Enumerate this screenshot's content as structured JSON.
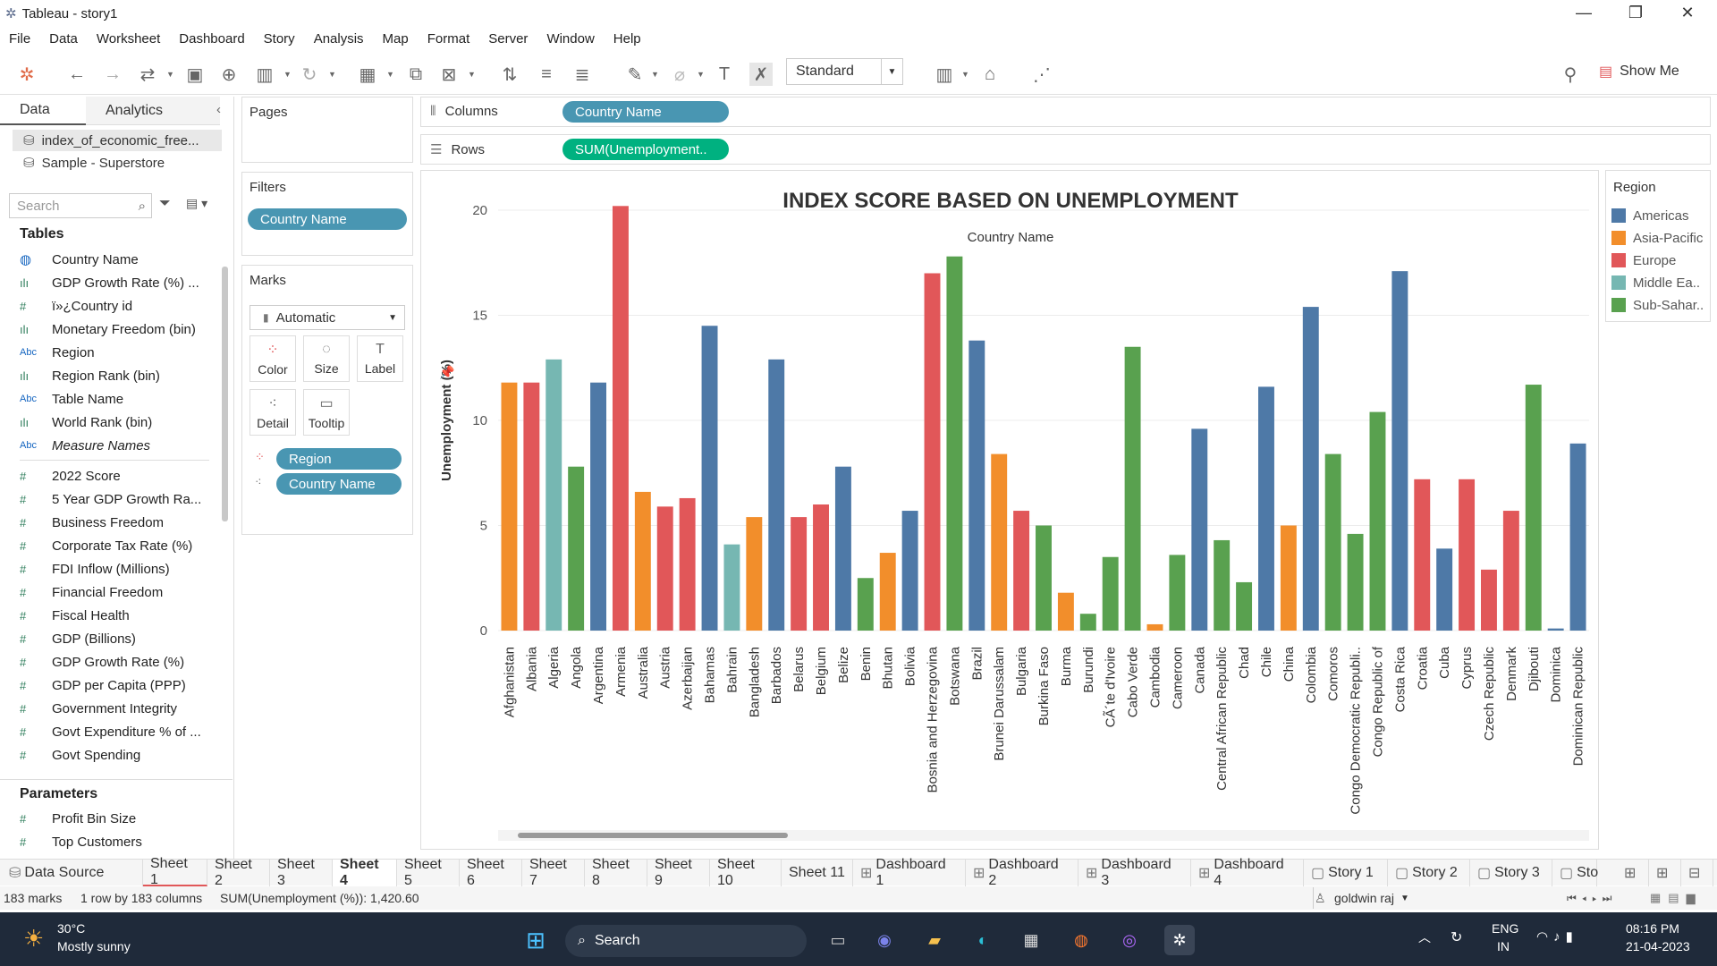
{
  "window": {
    "title": "Tableau - story1",
    "minimize": "—",
    "restore": "❐",
    "close": "✕"
  },
  "menu": [
    "File",
    "Data",
    "Worksheet",
    "Dashboard",
    "Story",
    "Analysis",
    "Map",
    "Format",
    "Server",
    "Window",
    "Help"
  ],
  "toolbar": {
    "fit_value": "Standard",
    "show_me": "Show Me"
  },
  "left_pane": {
    "tabs": [
      "Data",
      "Analytics"
    ],
    "data_sources": [
      "index_of_economic_free...",
      "Sample - Superstore"
    ],
    "search_placeholder": "Search",
    "tables_heading": "Tables",
    "dimensions": [
      {
        "icon": "globe",
        "name": "Country Name"
      },
      {
        "icon": "bin",
        "name": "GDP Growth Rate (%) ..."
      },
      {
        "icon": "num",
        "name": "ï»¿Country id"
      },
      {
        "icon": "bin",
        "name": "Monetary Freedom (bin)"
      },
      {
        "icon": "abc",
        "name": "Region"
      },
      {
        "icon": "bin",
        "name": "Region Rank (bin)"
      },
      {
        "icon": "abc",
        "name": "Table Name"
      },
      {
        "icon": "bin",
        "name": "World Rank (bin)"
      },
      {
        "icon": "abc",
        "name": "Measure Names"
      }
    ],
    "measures": [
      "2022 Score",
      "5 Year GDP Growth Ra...",
      "Business Freedom",
      "Corporate Tax Rate (%)",
      "FDI Inflow (Millions)",
      "Financial Freedom",
      "Fiscal Health",
      "GDP (Billions)",
      "GDP Growth Rate (%)",
      "GDP per Capita (PPP)",
      "Government Integrity",
      "Govt Expenditure % of ...",
      "Govt Spending"
    ],
    "parameters_heading": "Parameters",
    "parameters": [
      "Profit Bin Size",
      "Top Customers"
    ]
  },
  "shelves": {
    "pages": "Pages",
    "filters": "Filters",
    "filter_pill": "Country Name",
    "marks": "Marks",
    "mark_type": "Automatic",
    "mark_buttons": [
      "Color",
      "Size",
      "Label",
      "Detail",
      "Tooltip"
    ],
    "mark_pills": [
      "Region",
      "Country Name"
    ],
    "columns_label": "Columns",
    "columns_pill": "Country Name",
    "rows_label": "Rows",
    "rows_pill": "SUM(Unemployment.."
  },
  "legend": {
    "title": "Region",
    "items": [
      {
        "name": "Americas",
        "color": "#4e79a7"
      },
      {
        "name": "Asia-Pacific",
        "color": "#f28e2b"
      },
      {
        "name": "Europe",
        "color": "#e15759"
      },
      {
        "name": "Middle Ea..",
        "color": "#76b7b2"
      },
      {
        "name": "Sub-Sahar..",
        "color": "#59a14f"
      }
    ]
  },
  "chart_data": {
    "type": "bar",
    "title": "INDEX SCORE BASED ON UNEMPLOYMENT",
    "subtitle": "Country Name",
    "ylabel": "Unemployment (%)",
    "ylim": [
      0,
      20
    ],
    "yticks": [
      0,
      5,
      10,
      15,
      20
    ],
    "grid": true,
    "categories": [
      "Afghanistan",
      "Albania",
      "Algeria",
      "Angola",
      "Argentina",
      "Armenia",
      "Australia",
      "Austria",
      "Azerbaijan",
      "Bahamas",
      "Bahrain",
      "Bangladesh",
      "Barbados",
      "Belarus",
      "Belgium",
      "Belize",
      "Benin",
      "Bhutan",
      "Bolivia",
      "Bosnia and Herzegovina",
      "Botswana",
      "Brazil",
      "Brunei Darussalam",
      "Bulgaria",
      "Burkina Faso",
      "Burma",
      "Burundi",
      "CÃ´te d'Ivoire",
      "Cabo Verde",
      "Cambodia",
      "Cameroon",
      "Canada",
      "Central African Republic",
      "Chad",
      "Chile",
      "China",
      "Colombia",
      "Comoros",
      "Congo Democratic Republi..",
      "Congo Republic of",
      "Costa Rica",
      "Croatia",
      "Cuba",
      "Cyprus",
      "Czech Republic",
      "Denmark",
      "Djibouti",
      "Dominica",
      "Dominican Republic"
    ],
    "regions": [
      "Asia-Pacific",
      "Europe",
      "Middle Ea..",
      "Sub-Sahar..",
      "Americas",
      "Europe",
      "Asia-Pacific",
      "Europe",
      "Europe",
      "Americas",
      "Middle Ea..",
      "Asia-Pacific",
      "Americas",
      "Europe",
      "Europe",
      "Americas",
      "Sub-Sahar..",
      "Asia-Pacific",
      "Americas",
      "Europe",
      "Sub-Sahar..",
      "Americas",
      "Asia-Pacific",
      "Europe",
      "Sub-Sahar..",
      "Asia-Pacific",
      "Sub-Sahar..",
      "Sub-Sahar..",
      "Sub-Sahar..",
      "Asia-Pacific",
      "Sub-Sahar..",
      "Americas",
      "Sub-Sahar..",
      "Sub-Sahar..",
      "Americas",
      "Asia-Pacific",
      "Americas",
      "Sub-Sahar..",
      "Sub-Sahar..",
      "Sub-Sahar..",
      "Americas",
      "Europe",
      "Americas",
      "Europe",
      "Europe",
      "Europe",
      "Sub-Sahar..",
      "Americas",
      "Americas"
    ],
    "values": [
      11.8,
      11.8,
      12.9,
      7.8,
      11.8,
      20.2,
      6.6,
      5.9,
      6.3,
      14.5,
      4.1,
      5.4,
      12.9,
      5.4,
      6.0,
      7.8,
      2.5,
      3.7,
      5.7,
      17.0,
      17.8,
      13.8,
      8.4,
      5.7,
      5.0,
      1.8,
      0.8,
      3.5,
      13.5,
      0.3,
      3.6,
      9.6,
      4.3,
      2.3,
      11.6,
      5.0,
      15.4,
      8.4,
      4.6,
      10.4,
      17.1,
      7.2,
      3.9,
      7.2,
      2.9,
      5.7,
      11.7,
      0.1,
      8.9
    ]
  },
  "sheet_tabs": [
    "Data Source",
    "Sheet 1",
    "Sheet 2",
    "Sheet 3",
    "Sheet 4",
    "Sheet 5",
    "Sheet 6",
    "Sheet 7",
    "Sheet 8",
    "Sheet 9",
    "Sheet 10",
    "Sheet 11",
    "Dashboard 1",
    "Dashboard 2",
    "Dashboard 3",
    "Dashboard 4",
    "Story 1",
    "Story 2",
    "Story 3",
    "Sto"
  ],
  "status": {
    "marks": "183 marks",
    "dims": "1 row by 183 columns",
    "sum": "SUM(Unemployment (%)): 1,420.60",
    "user": "goldwin raj"
  },
  "taskbar": {
    "weather_temp": "30°C",
    "weather_desc": "Mostly sunny",
    "search": "Search",
    "lang1": "ENG",
    "lang2": "IN",
    "time": "08:16 PM",
    "date": "21-04-2023"
  }
}
